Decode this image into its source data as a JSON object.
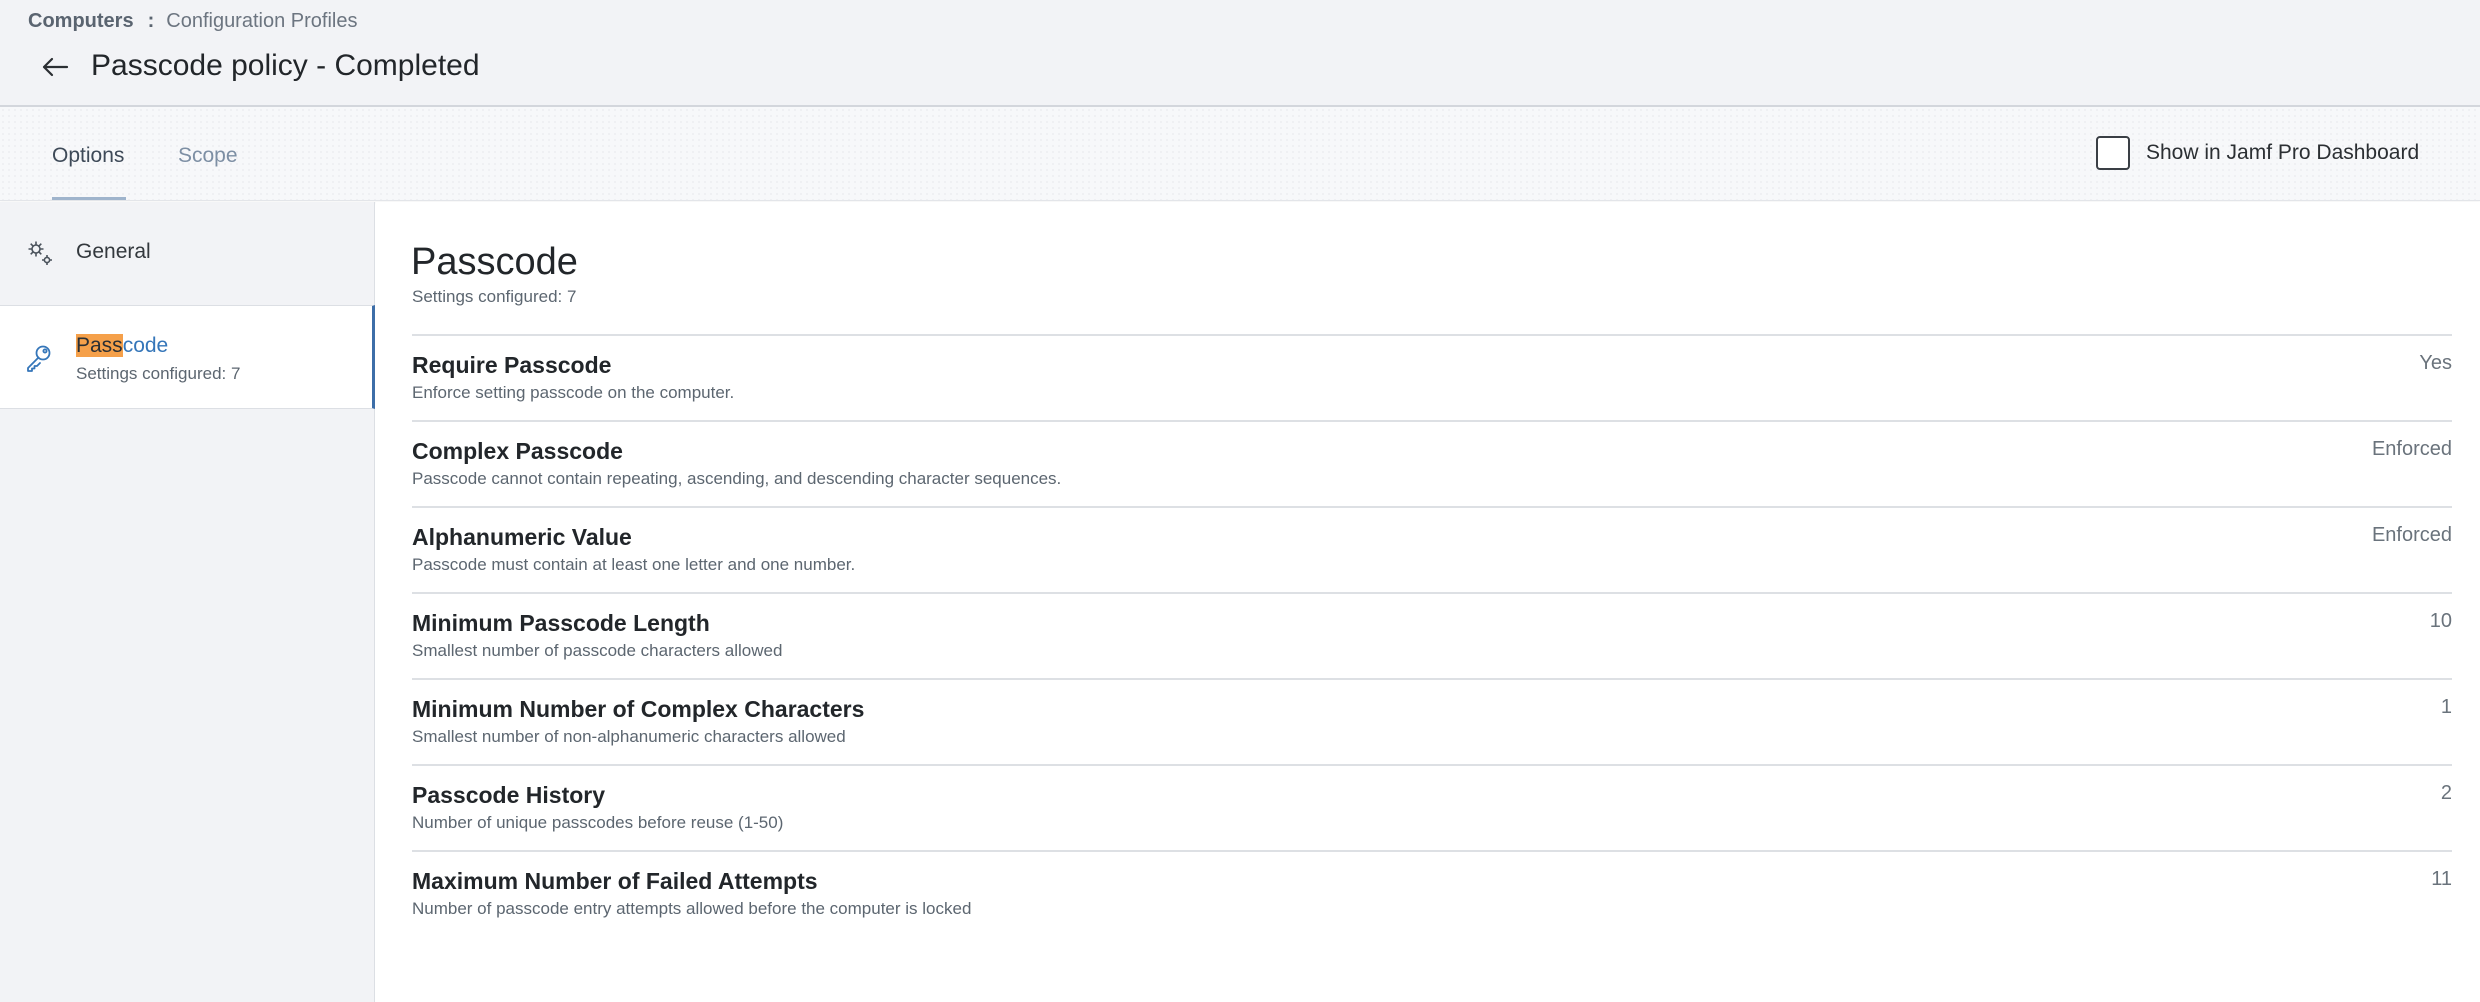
{
  "breadcrumb": {
    "root": "Computers",
    "separator": ":",
    "current": "Configuration Profiles"
  },
  "header": {
    "title": "Passcode policy - Completed",
    "back_icon": "arrow-left-icon"
  },
  "tabs": [
    {
      "label": "Options",
      "active": true
    },
    {
      "label": "Scope",
      "active": false
    }
  ],
  "dashboard_toggle": {
    "label": "Show in Jamf Pro Dashboard",
    "checked": false
  },
  "sidebar": {
    "items": [
      {
        "label": "General",
        "icon": "gears-icon",
        "selected": false
      },
      {
        "label": "Passcode",
        "highlight": "Pass",
        "rest": "code",
        "subtitle": "Settings configured: 7",
        "icon": "key-icon",
        "selected": true
      }
    ]
  },
  "main": {
    "title": "Passcode",
    "subtitle": "Settings configured: 7",
    "settings": [
      {
        "name": "Require Passcode",
        "description": "Enforce setting passcode on the computer.",
        "value": "Yes"
      },
      {
        "name": "Complex Passcode",
        "description": "Passcode cannot contain repeating, ascending, and descending character sequences.",
        "value": "Enforced"
      },
      {
        "name": "Alphanumeric Value",
        "description": "Passcode must contain at least one letter and one number.",
        "value": "Enforced"
      },
      {
        "name": "Minimum Passcode Length",
        "description": "Smallest number of passcode characters allowed",
        "value": "10"
      },
      {
        "name": "Minimum Number of Complex Characters",
        "description": "Smallest number of non-alphanumeric characters allowed",
        "value": "1"
      },
      {
        "name": "Passcode History",
        "description": "Number of unique passcodes before reuse (1-50)",
        "value": "2"
      },
      {
        "name": "Maximum Number of Failed Attempts",
        "description": "Number of passcode entry attempts allowed before the computer is locked",
        "value": "11"
      }
    ]
  },
  "colors": {
    "accent_blue": "#3576b9",
    "search_highlight": "#f5a04a",
    "header_bg": "#f2f3f6"
  }
}
